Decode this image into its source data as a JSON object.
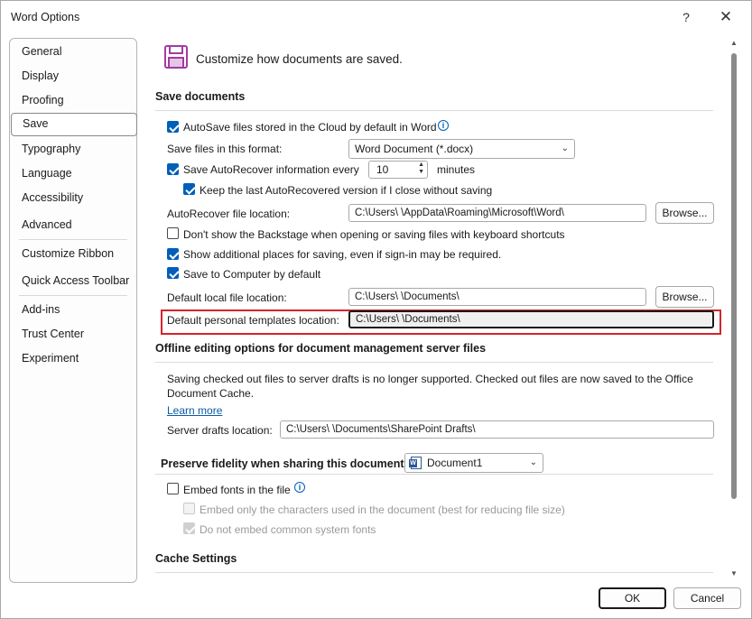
{
  "window": {
    "title": "Word Options",
    "help_label": "?",
    "close_label": "✕"
  },
  "nav": {
    "items": [
      {
        "label": "General"
      },
      {
        "label": "Display"
      },
      {
        "label": "Proofing"
      },
      {
        "label": "Save"
      },
      {
        "label": "Typography"
      },
      {
        "label": "Language"
      },
      {
        "label": "Accessibility"
      },
      {
        "label": "Advanced"
      },
      {
        "label": "Customize Ribbon"
      },
      {
        "label": "Quick Access Toolbar"
      },
      {
        "label": "Add-ins"
      },
      {
        "label": "Trust Center"
      },
      {
        "label": "Experiment"
      }
    ],
    "selected": "Save"
  },
  "header": {
    "text": "Customize how documents are saved."
  },
  "save_documents": {
    "title": "Save documents",
    "autosave_label": "AutoSave files stored in the Cloud by default in Word",
    "format_label": "Save files in this format:",
    "format_value": "Word Document (*.docx)",
    "autorecover_label": "Save AutoRecover information every",
    "autorecover_minutes": "10",
    "minutes_label": "minutes",
    "keep_last_label": "Keep the last AutoRecovered version if I close without saving",
    "autorecover_location_label": "AutoRecover file location:",
    "autorecover_location_value": "C:\\Users\\            \\AppData\\Roaming\\Microsoft\\Word\\",
    "browse_label": "Browse...",
    "backstage_label": "Don't show the Backstage when opening or saving files with keyboard shortcuts",
    "additional_places_label": "Show additional places for saving, even if sign-in may be required.",
    "save_to_computer_label": "Save to Computer by default",
    "default_local_label": "Default local file location:",
    "default_local_value": "C:\\Users\\            \\Documents\\",
    "browse2_label": "Browse...",
    "templates_label": "Default personal templates location:",
    "templates_value": "C:\\Users\\             \\Documents\\"
  },
  "offline": {
    "title": "Offline editing options for document management server files",
    "notice_line1": "Saving checked out files to server drafts is no longer supported. Checked out files are now saved to the Office",
    "notice_line2": "Document Cache.",
    "learn_more": "Learn more",
    "drafts_label": "Server drafts location:",
    "drafts_value": "C:\\Users\\              \\Documents\\SharePoint Drafts\\"
  },
  "fidelity": {
    "title": "Preserve fidelity when sharing this document:",
    "document_value": "Document1",
    "embed_fonts_label": "Embed fonts in the file",
    "embed_chars_label": "Embed only the characters used in the document (best for reducing file size)",
    "no_common_label": "Do not embed common system fonts"
  },
  "cache": {
    "title": "Cache Settings"
  },
  "footer": {
    "ok_label": "OK",
    "cancel_label": "Cancel"
  },
  "colors": {
    "accent": "#005fb8",
    "highlight_border": "#d6232c",
    "save_icon": "#a33aa3"
  }
}
